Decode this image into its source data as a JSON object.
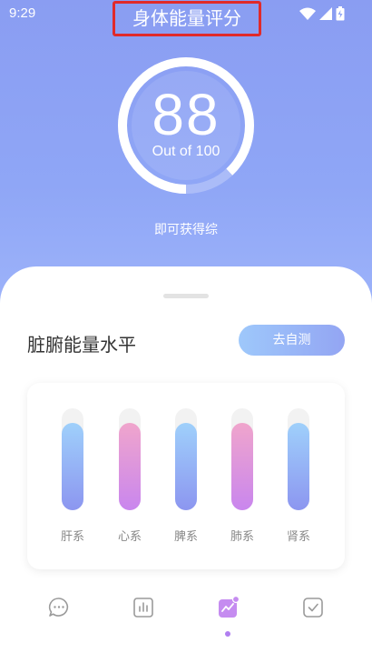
{
  "status_bar": {
    "time": "9:29"
  },
  "header": {
    "title": "身体能量评分"
  },
  "score": {
    "value": "88",
    "subtitle": "Out of 100",
    "fraction": 0.88
  },
  "hint": "即可获得综",
  "organ_section": {
    "title": "脏腑能量水平",
    "test_button": "去自测",
    "bars": [
      {
        "label": "肝系",
        "level": 0.86,
        "color": "blue"
      },
      {
        "label": "心系",
        "level": 0.86,
        "color": "pink"
      },
      {
        "label": "脾系",
        "level": 0.86,
        "color": "blue"
      },
      {
        "label": "肺系",
        "level": 0.86,
        "color": "pink"
      },
      {
        "label": "肾系",
        "level": 0.86,
        "color": "blue"
      }
    ]
  },
  "bottom_nav": {
    "items": [
      {
        "icon": "chat-icon",
        "active": false
      },
      {
        "icon": "chart-icon",
        "active": false
      },
      {
        "icon": "trend-icon",
        "active": true
      },
      {
        "icon": "check-icon",
        "active": false
      }
    ]
  },
  "colors": {
    "accent_purple": "#b07ef0",
    "title_box_border": "#e02a2a"
  }
}
